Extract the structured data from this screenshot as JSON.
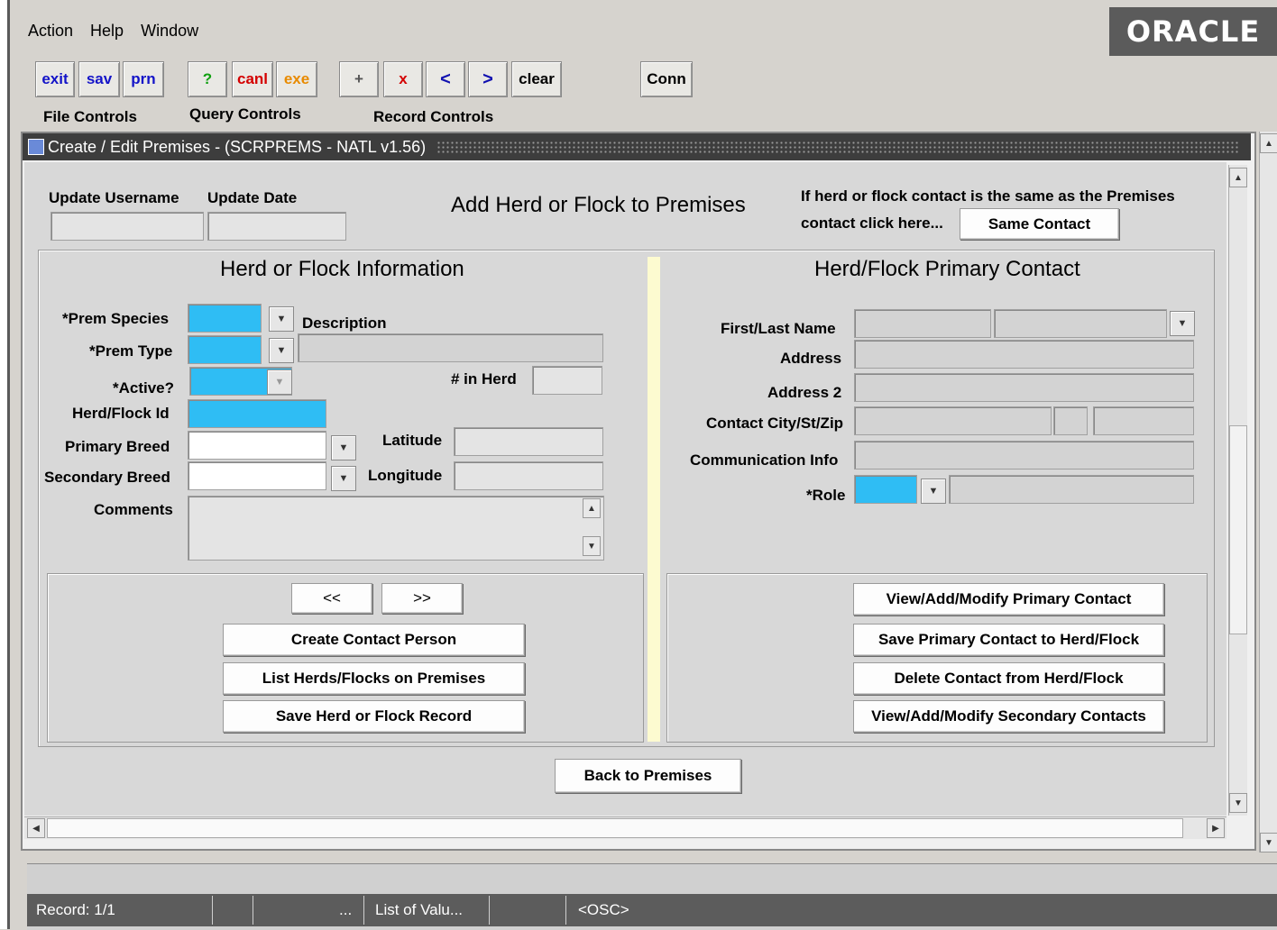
{
  "menu": {
    "action": "Action",
    "help": "Help",
    "window": "Window"
  },
  "brand": {
    "logo": "ORACLE"
  },
  "toolbar": {
    "exit": "exit",
    "sav": "sav",
    "prn": "prn",
    "query": "?",
    "canl": "canl",
    "exe": "exe",
    "add": "+",
    "delete": "x",
    "prev": "<",
    "next": ">",
    "clear": "clear",
    "conn": "Conn",
    "file_controls": "File Controls",
    "query_controls": "Query Controls",
    "record_controls": "Record Controls"
  },
  "window": {
    "title": "Create / Edit Premises - (SCRPREMS - NATL v1.56)"
  },
  "header": {
    "update_username": "Update Username",
    "update_date": "Update Date",
    "heading": "Add Herd or Flock to Premises",
    "same_contact_note_1": "If herd or flock contact is the same as the Premises",
    "same_contact_note_2": "contact click here...",
    "same_contact_button": "Same Contact"
  },
  "herd": {
    "title": "Herd or Flock Information",
    "prem_species": "*Prem Species",
    "description": "Description",
    "prem_type": "*Prem Type",
    "active": "*Active?",
    "in_herd": "# in Herd",
    "herd_id": "Herd/Flock Id",
    "primary_breed": "Primary Breed",
    "latitude": "Latitude",
    "secondary_breed": "Secondary Breed",
    "longitude": "Longitude",
    "comments": "Comments",
    "prev_record": "<<",
    "next_record": ">>",
    "create_contact": "Create Contact Person",
    "list_herds": "List Herds/Flocks on Premises",
    "save_herd": "Save Herd or Flock Record"
  },
  "contact": {
    "title": "Herd/Flock Primary Contact",
    "first_last_name": "First/Last Name",
    "address": "Address",
    "address2": "Address 2",
    "city_st_zip": "Contact City/St/Zip",
    "communication": "Communication Info",
    "role": "*Role",
    "view_primary": "View/Add/Modify Primary Contact",
    "save_primary": "Save Primary Contact to Herd/Flock",
    "delete_contact": "Delete Contact from Herd/Flock",
    "view_secondary": "View/Add/Modify Secondary Contacts"
  },
  "footer": {
    "back": "Back to Premises"
  },
  "status": {
    "record": "Record: 1/1",
    "ellipsis": "...",
    "lov": "List of Valu...",
    "osc": "<OSC>"
  },
  "colors": {
    "required_field": "#2fbdf4",
    "titlebar": "#3d3d3d",
    "separator": "#fdfbd0"
  }
}
